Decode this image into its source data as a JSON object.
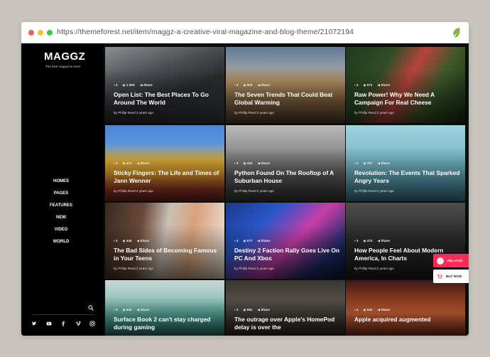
{
  "browser": {
    "url": "https://themeforest.net/item/maggz-a-creative-viral-magazine-and-blog-theme/21072194"
  },
  "sidebar": {
    "logo": "MAGGZ",
    "tagline": "The best magazine ever!",
    "nav": [
      "HOMES",
      "PAGES",
      "FEATURES",
      "NEW",
      "VIDEO",
      "WORLD"
    ],
    "socials": [
      "twitter-icon",
      "youtube-icon",
      "facebook-icon",
      "vimeo-icon",
      "instagram-icon"
    ]
  },
  "floating": {
    "related": "RELATED",
    "buy": "BUY NOW"
  },
  "posts": [
    {
      "title": "Open List: The Best Places To Go Around The World",
      "comments": "3",
      "views": "1.35K",
      "share": "Share",
      "byline": "by Phillip Reed 2 years ago",
      "bg": "linear-gradient(160deg,#8b8e91 0%,#4a4d52 35%,#2a2c30 60%,#3b3e40 100%)"
    },
    {
      "title": "The Seven Trends That Could Beat Global Warming",
      "comments": "3",
      "views": "903",
      "share": "Share",
      "byline": "by Phillip Reed 2 years ago",
      "bg": "linear-gradient(180deg,#5f7b97 0%,#8f9aa3 25%,#b59364 45%,#8a6a45 70%,#5a4330 100%)"
    },
    {
      "title": "Raw Power! Why We Need A Campaign For Real Cheese",
      "comments": "3",
      "views": "672",
      "share": "Share",
      "byline": "by Phillip Reed 2 years ago",
      "bg": "linear-gradient(120deg,#1e3a1c 0%,#2f4d25 30%,#b7433a 50%,#3c5a2a 70%,#1b2a16 100%)"
    },
    {
      "title": "Sticky Fingers: The Life and Times of Jann Wenner",
      "comments": "3",
      "views": "471",
      "share": "Share",
      "byline": "by Phillip Reed 2 years ago",
      "bg": "linear-gradient(180deg,#4a86d6 0%,#5a95dc 25%,#e0b23b 45%,#d4932a 65%,#9c3a28 85%,#6b2a1f 100%)"
    },
    {
      "title": "Python Found On The Rooftop of A Suburban House",
      "comments": "3",
      "views": "416",
      "share": "Share",
      "byline": "by Phillip Reed 2 years ago",
      "bg": "linear-gradient(180deg,#b9b9b9 0%,#8d8d8d 35%,#5c5c5c 65%,#3a3a3a 100%)"
    },
    {
      "title": "Revolution: The Events That Sparked Angry Years",
      "comments": "3",
      "views": "757",
      "share": "Share",
      "byline": "by Phillip Reed 2 years ago",
      "bg": "linear-gradient(180deg,#9fd3df 0%,#7cbccb 40%,#5a9eb0 75%,#3f7f91 100%)"
    },
    {
      "title": "The Bad Sides of Becoming Famous in Your Teens",
      "comments": "3",
      "views": "440",
      "share": "Share",
      "byline": "by Phillip Reed 2 years ago",
      "bg": "linear-gradient(100deg,#3a2a22 0%,#6a4a38 30%,#c9bfb5 50%,#d9a27a 70%,#e9e4de 100%)"
    },
    {
      "title": "Destiny 2 Faction Rally Goes Live On PC And Xbox",
      "comments": "3",
      "views": "577",
      "share": "Share",
      "byline": "by Phillip Reed 2 years ago",
      "bg": "linear-gradient(135deg,#1b3a8a 0%,#2a56c9 30%,#c83ea8 55%,#1d2d6b 80%,#0d1633 100%)"
    },
    {
      "title": "How People Feel About Modern America, In Charts",
      "comments": "3",
      "views": "472",
      "share": "Share",
      "byline": "by Phillip Reed 2 years ago",
      "bg": "linear-gradient(180deg,#4d4d4d 0%,#2e2e2e 40%,#1c1c1c 100%)"
    },
    {
      "title": "Surface Book 2 can't stay charged during gaming",
      "comments": "3",
      "views": "543",
      "share": "Share",
      "byline": "",
      "bg": "linear-gradient(180deg,#c7d6d4 0%,#8ec3b7 40%,#4aa79a 70%,#2b6f66 100%)"
    },
    {
      "title": "The outrage over Apple's HomePod delay is over the",
      "comments": "3",
      "views": "981",
      "share": "Share",
      "byline": "",
      "bg": "linear-gradient(180deg,#3a3733 0%,#56504a 40%,#2b2824 100%)"
    },
    {
      "title": "Apple acquired augmented",
      "comments": "3",
      "views": "642",
      "share": "Share",
      "byline": "",
      "bg": "linear-gradient(180deg,#3b1a14 0%,#8c3b23 35%,#d86a37 60%,#7a2e1e 100%)"
    }
  ]
}
